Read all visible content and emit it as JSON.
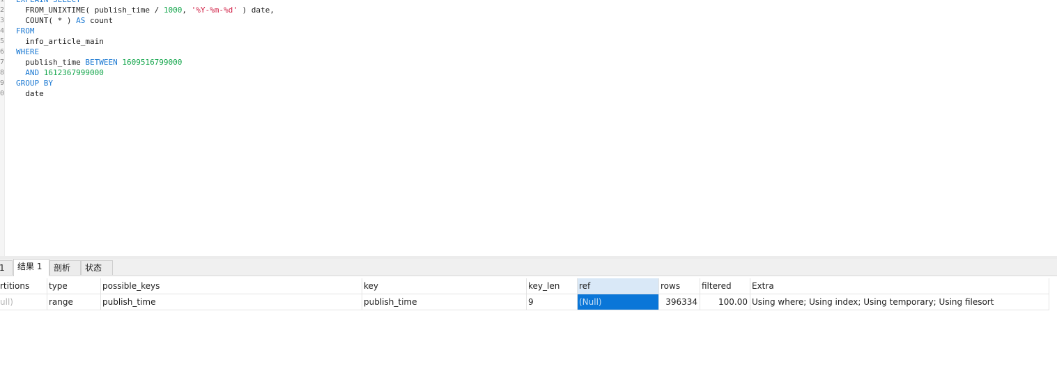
{
  "editor": {
    "lines": [
      {
        "no": "1",
        "tokens": [
          {
            "t": "EXPLAIN SELECT",
            "c": "kw"
          }
        ]
      },
      {
        "no": "2",
        "tokens": [
          {
            "t": "  FROM_UNIXTIME( publish_time / ",
            "c": ""
          },
          {
            "t": "1000",
            "c": "num"
          },
          {
            "t": ", ",
            "c": ""
          },
          {
            "t": "'%Y-%m-%d'",
            "c": "str"
          },
          {
            "t": " ) date,",
            "c": ""
          }
        ]
      },
      {
        "no": "3",
        "tokens": [
          {
            "t": "  COUNT( * ) ",
            "c": ""
          },
          {
            "t": "AS",
            "c": "kw"
          },
          {
            "t": " count",
            "c": ""
          }
        ]
      },
      {
        "no": "4",
        "tokens": [
          {
            "t": "FROM",
            "c": "kw"
          }
        ]
      },
      {
        "no": "5",
        "tokens": [
          {
            "t": "  info_article_main",
            "c": ""
          }
        ]
      },
      {
        "no": "6",
        "tokens": [
          {
            "t": "WHERE",
            "c": "kw"
          }
        ]
      },
      {
        "no": "7",
        "tokens": [
          {
            "t": "  publish_time ",
            "c": ""
          },
          {
            "t": "BETWEEN",
            "c": "kw"
          },
          {
            "t": " ",
            "c": ""
          },
          {
            "t": "1609516799000",
            "c": "num"
          }
        ]
      },
      {
        "no": "8",
        "tokens": [
          {
            "t": "  ",
            "c": ""
          },
          {
            "t": "AND",
            "c": "kw"
          },
          {
            "t": " ",
            "c": ""
          },
          {
            "t": "1612367999000",
            "c": "num"
          }
        ]
      },
      {
        "no": "9",
        "tokens": [
          {
            "t": "GROUP BY",
            "c": "kw"
          }
        ]
      },
      {
        "no": "0",
        "tokens": [
          {
            "t": "  date",
            "c": ""
          }
        ]
      }
    ]
  },
  "tabs": {
    "info": "1",
    "result": "结果 1",
    "profile": "剖析",
    "status": "状态"
  },
  "grid": {
    "headers": {
      "partitions": "rtitions",
      "type": "type",
      "possible_keys": "possible_keys",
      "key": "key",
      "key_len": "key_len",
      "ref": "ref",
      "rows": "rows",
      "filtered": "filtered",
      "extra": "Extra"
    },
    "row": {
      "partitions": "ull)",
      "type": "range",
      "possible_keys": "publish_time",
      "key": "publish_time",
      "key_len": "9",
      "ref": "(Null)",
      "rows": "396334",
      "filtered": "100.00",
      "extra": "Using where; Using index; Using temporary; Using filesort"
    }
  },
  "colors": {
    "keyword": "#1a78d2",
    "number": "#12a54a",
    "string": "#d01d43",
    "selection": "#0a76d8"
  }
}
